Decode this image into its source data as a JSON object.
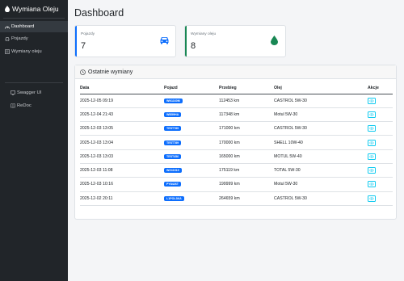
{
  "sidebar": {
    "brand": "Wymiana Oleju",
    "nav": [
      {
        "label": "Dashboard",
        "icon": "speedometer-icon"
      },
      {
        "label": "Pojazdy",
        "icon": "car-icon"
      },
      {
        "label": "Wymiany oleju",
        "icon": "list-icon"
      }
    ],
    "docs": [
      {
        "label": "Swagger UI",
        "icon": "monitor-icon"
      },
      {
        "label": "ReDoc",
        "icon": "book-icon"
      }
    ]
  },
  "header": {
    "title": "Dashboard"
  },
  "cards": [
    {
      "label": "Pojazdy",
      "value": "7",
      "color": "#0d6efd",
      "icon": "car-icon"
    },
    {
      "label": "Wymiany oleju",
      "value": "8",
      "color": "#198754",
      "icon": "oil-drop-icon"
    }
  ],
  "recent": {
    "title": "Ostatnie wymiany",
    "columns": [
      "Data",
      "Pojazd",
      "Przebieg",
      "Olej",
      "Akcje"
    ],
    "rows": [
      {
        "date": "2025-12-05 09:19",
        "plate": "WN1160M",
        "mileage": "112453 km",
        "oil": "CASTROL 5W-30"
      },
      {
        "date": "2025-12-04 21:43",
        "plate": "WB59HA",
        "mileage": "117348 km",
        "oil": "Motul 5W-30"
      },
      {
        "date": "2025-12-03 13:05",
        "plate": "TEST789",
        "mileage": "171000 km",
        "oil": "CASTROL 5W-30"
      },
      {
        "date": "2025-12-03 13:04",
        "plate": "TEST789",
        "mileage": "170000 km",
        "oil": "SHELL 10W-40"
      },
      {
        "date": "2025-12-03 13:03",
        "plate": "TEST456",
        "mileage": "165000 km",
        "oil": "MOTUL 5W-40"
      },
      {
        "date": "2025-12-03 11:08",
        "plate": "WZ41919",
        "mileage": "175119 km",
        "oil": "TOTAL 5W-30"
      },
      {
        "date": "2025-12-03 10:16",
        "plate": "PY8426T",
        "mileage": "199999 km",
        "oil": "Motul 5W-30"
      },
      {
        "date": "2025-12-02 20:11",
        "plate": "L1POL3KA",
        "mileage": "264659 km",
        "oil": "CASTROL 5W-30"
      }
    ]
  }
}
